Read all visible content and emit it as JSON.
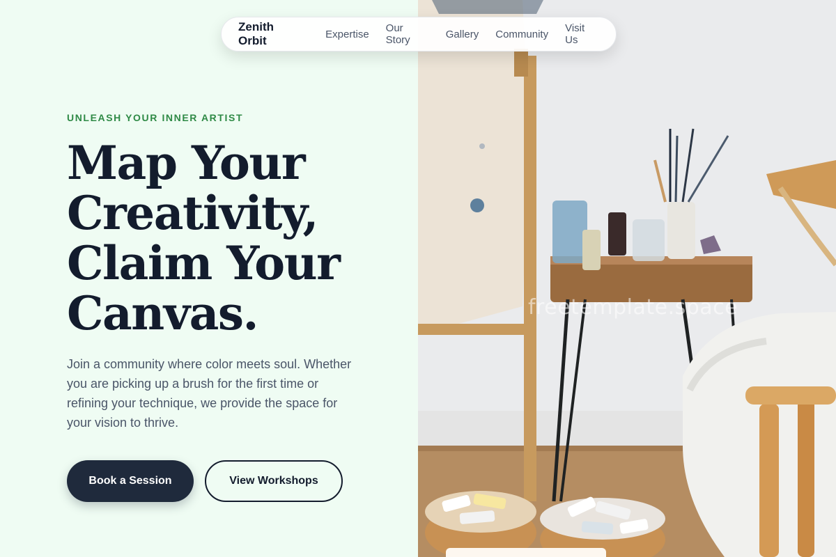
{
  "nav": {
    "brand": "Zenith Orbit",
    "links": [
      "Expertise",
      "Our Story",
      "Gallery",
      "Community",
      "Visit Us"
    ]
  },
  "hero": {
    "eyebrow": "UNLEASH YOUR INNER ARTIST",
    "headline_lines": [
      "Map Your",
      "Creativity,",
      "Claim Your",
      "Canvas."
    ],
    "lead": "Join a community where color meets soul. Whether you are picking up a brush for the first time or refining your technique, we provide the space for your vision to thrive.",
    "primary_cta": "Book a Session",
    "secondary_cta": "View Workshops"
  },
  "photo": {
    "watermark": "freetemplate.space"
  },
  "colors": {
    "background": "#effcf3",
    "accent": "#2f8a46",
    "dark": "#131c2d",
    "button": "#1f2a3c"
  }
}
